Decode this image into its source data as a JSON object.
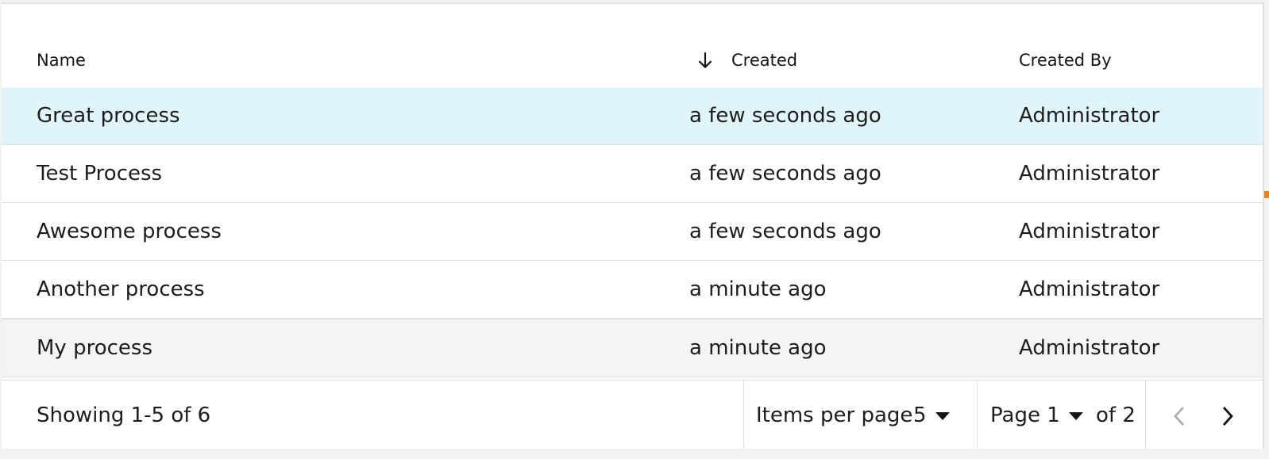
{
  "table": {
    "columns": {
      "name": "Name",
      "created": "Created",
      "created_by": "Created By"
    },
    "sort_icon": "arrow-down-icon",
    "rows": [
      {
        "name": "Great process",
        "created": "a few seconds ago",
        "created_by": "Administrator",
        "state": "selected"
      },
      {
        "name": "Test Process",
        "created": "a few seconds ago",
        "created_by": "Administrator",
        "state": "normal"
      },
      {
        "name": "Awesome process",
        "created": "a few seconds ago",
        "created_by": "Administrator",
        "state": "normal"
      },
      {
        "name": "Another process",
        "created": "a minute ago",
        "created_by": "Administrator",
        "state": "normal"
      },
      {
        "name": "My process",
        "created": "a minute ago",
        "created_by": "Administrator",
        "state": "hover"
      }
    ]
  },
  "pagination": {
    "showing": "Showing 1-5 of 6",
    "items_per_page_label": "Items per page",
    "items_per_page_value": "5",
    "page_value": "Page 1",
    "of_pages": "of 2",
    "prev_icon": "chevron-left-icon",
    "next_icon": "chevron-right-icon"
  },
  "colors": {
    "selected_row": "#e0f5f9",
    "hover_row": "#f4f4f4",
    "accent_edge": "#e8822a"
  }
}
